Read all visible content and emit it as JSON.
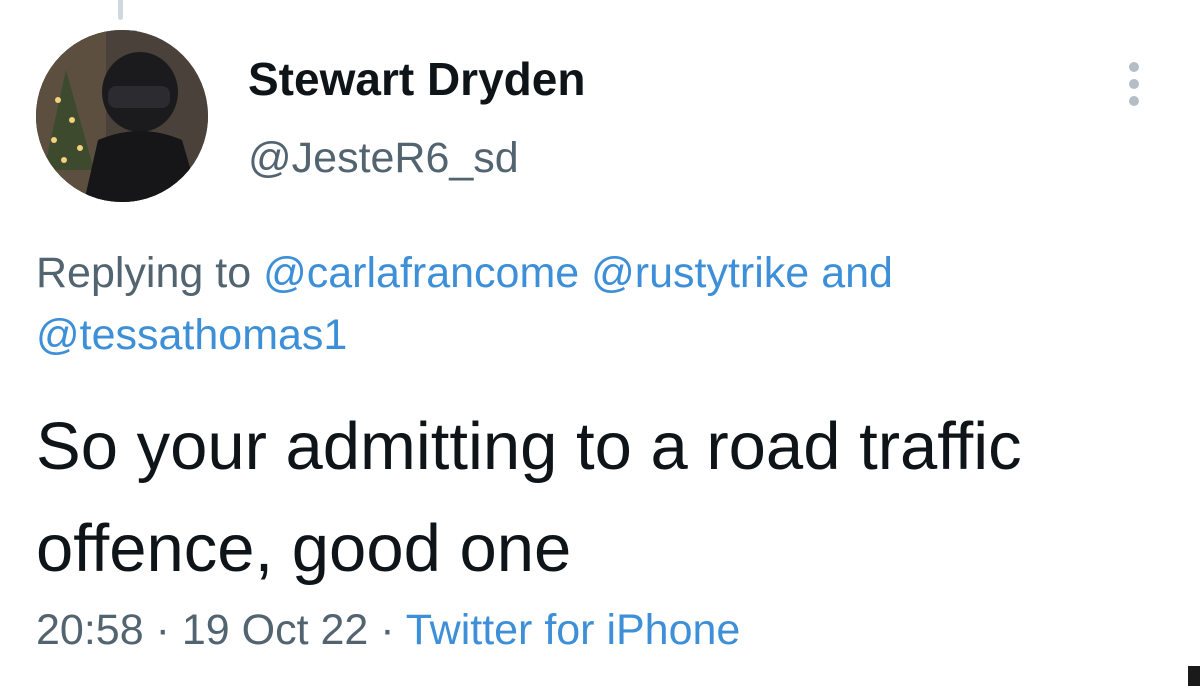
{
  "author": {
    "display_name": "Stewart Dryden",
    "handle": "@JesteR6_sd"
  },
  "icons": {
    "more": "more-vertical-icon",
    "avatar": "avatar"
  },
  "reply": {
    "prefix": "Replying to",
    "mentions": [
      "@carlafrancome",
      "@rustytrike",
      "@tessathomas1"
    ],
    "conjunction": "and"
  },
  "tweet": {
    "text": "So your admitting to a road traffic offence, good one"
  },
  "meta": {
    "time": "20:58",
    "separator": "·",
    "date": "19 Oct 22",
    "source": "Twitter for iPhone"
  },
  "colors": {
    "link": "#3d8fd8",
    "secondary_text": "#536471",
    "primary_text": "#0f1419"
  }
}
